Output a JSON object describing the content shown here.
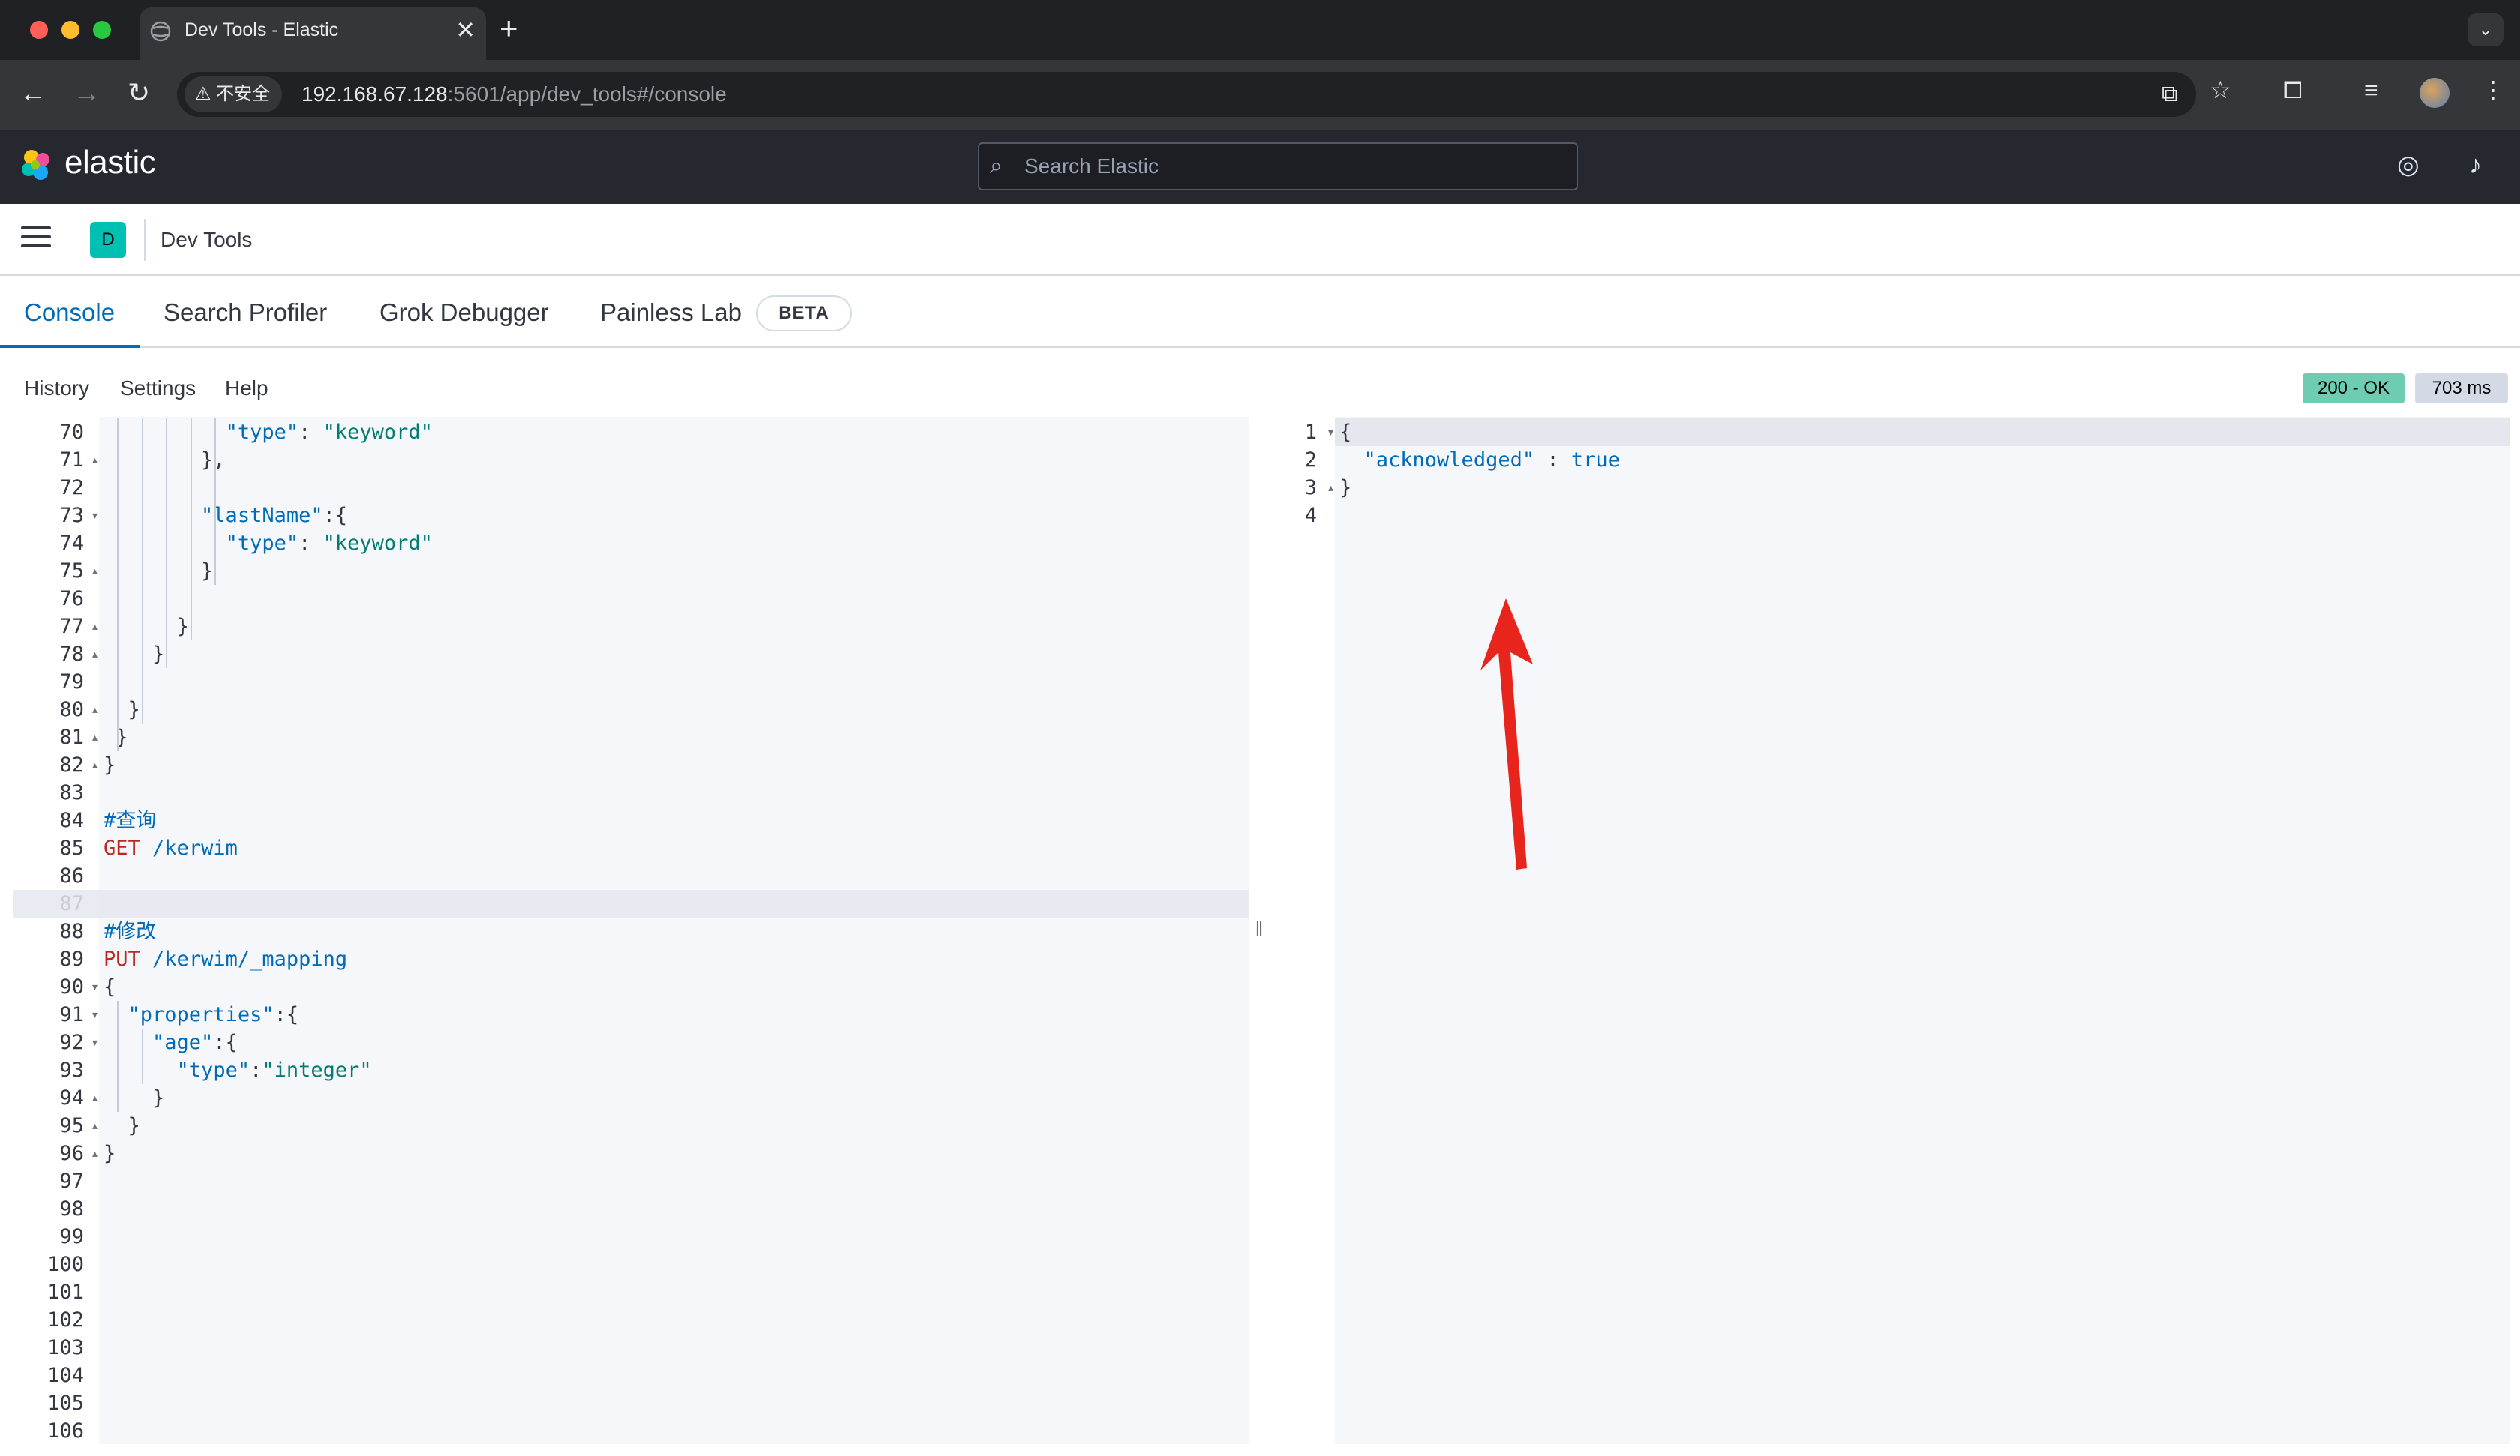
{
  "browser": {
    "tab_title": "Dev Tools - Elastic",
    "close_glyph": "✕",
    "new_tab_glyph": "+",
    "security_label": "⚠ 不安全",
    "url_host": "192.168.67.128",
    "url_path": ":5601/app/dev_tools#/console",
    "icons": [
      "back-icon",
      "forward-icon",
      "reload-icon",
      "translate-icon",
      "bookmark-star-icon",
      "extensions-icon",
      "reading-list-icon",
      "profile-avatar",
      "more-menu-icon",
      "tab-search-icon"
    ]
  },
  "kibana": {
    "brand": "elastic",
    "search_placeholder": "Search Elastic",
    "space_initial": "D",
    "breadcrumb": "Dev Tools"
  },
  "tabs": [
    {
      "label": "Console",
      "active": true
    },
    {
      "label": "Search Profiler",
      "active": false
    },
    {
      "label": "Grok Debugger",
      "active": false
    },
    {
      "label": "Painless Lab",
      "active": false
    }
  ],
  "beta_badge": "BETA",
  "console_menu": {
    "history": "History",
    "settings": "Settings",
    "help": "Help",
    "status": "200 - OK",
    "time": "703 ms"
  },
  "editor": {
    "highlighted_line": "87",
    "lines": [
      {
        "n": "70",
        "fold": "",
        "code": "          \"type\": \"keyword\""
      },
      {
        "n": "71",
        "fold": "▴",
        "code": "        },"
      },
      {
        "n": "72",
        "fold": "",
        "code": ""
      },
      {
        "n": "73",
        "fold": "▾",
        "code": "        \"lastName\":{"
      },
      {
        "n": "74",
        "fold": "",
        "code": "          \"type\": \"keyword\""
      },
      {
        "n": "75",
        "fold": "▴",
        "code": "        }"
      },
      {
        "n": "76",
        "fold": "",
        "code": ""
      },
      {
        "n": "77",
        "fold": "▴",
        "code": "      }"
      },
      {
        "n": "78",
        "fold": "▴",
        "code": "    }"
      },
      {
        "n": "79",
        "fold": "",
        "code": ""
      },
      {
        "n": "80",
        "fold": "▴",
        "code": "  }"
      },
      {
        "n": "81",
        "fold": "▴",
        "code": " }"
      },
      {
        "n": "82",
        "fold": "▴",
        "code": "}"
      },
      {
        "n": "83",
        "fold": "",
        "code": ""
      },
      {
        "n": "84",
        "fold": "",
        "code": "#查询"
      },
      {
        "n": "85",
        "fold": "",
        "code": "GET /kerwim"
      },
      {
        "n": "86",
        "fold": "",
        "code": ""
      },
      {
        "n": "87",
        "fold": "",
        "code": ""
      },
      {
        "n": "88",
        "fold": "",
        "code": "#修改"
      },
      {
        "n": "89",
        "fold": "",
        "code": "PUT /kerwim/_mapping"
      },
      {
        "n": "90",
        "fold": "▾",
        "code": "{"
      },
      {
        "n": "91",
        "fold": "▾",
        "code": "  \"properties\":{"
      },
      {
        "n": "92",
        "fold": "▾",
        "code": "    \"age\":{"
      },
      {
        "n": "93",
        "fold": "",
        "code": "      \"type\":\"integer\""
      },
      {
        "n": "94",
        "fold": "▴",
        "code": "    }"
      },
      {
        "n": "95",
        "fold": "▴",
        "code": "  }"
      },
      {
        "n": "96",
        "fold": "▴",
        "code": "}"
      },
      {
        "n": "97",
        "fold": "",
        "code": ""
      },
      {
        "n": "98",
        "fold": "",
        "code": ""
      },
      {
        "n": "99",
        "fold": "",
        "code": ""
      },
      {
        "n": "100",
        "fold": "",
        "code": ""
      },
      {
        "n": "101",
        "fold": "",
        "code": ""
      },
      {
        "n": "102",
        "fold": "",
        "code": ""
      },
      {
        "n": "103",
        "fold": "",
        "code": ""
      },
      {
        "n": "104",
        "fold": "",
        "code": ""
      },
      {
        "n": "105",
        "fold": "",
        "code": ""
      },
      {
        "n": "106",
        "fold": "",
        "code": ""
      }
    ]
  },
  "output": {
    "lines": [
      {
        "n": "1",
        "fold": "▾",
        "code": "{"
      },
      {
        "n": "2",
        "fold": "",
        "code": "  \"acknowledged\" : true"
      },
      {
        "n": "3",
        "fold": "▴",
        "code": "}"
      },
      {
        "n": "4",
        "fold": "",
        "code": ""
      }
    ]
  },
  "colors": {
    "accent": "#006bb8",
    "string": "#017d73",
    "method": "#bd271e",
    "status_ok": "#6dccb1",
    "annotation_arrow": "#e8251d"
  }
}
